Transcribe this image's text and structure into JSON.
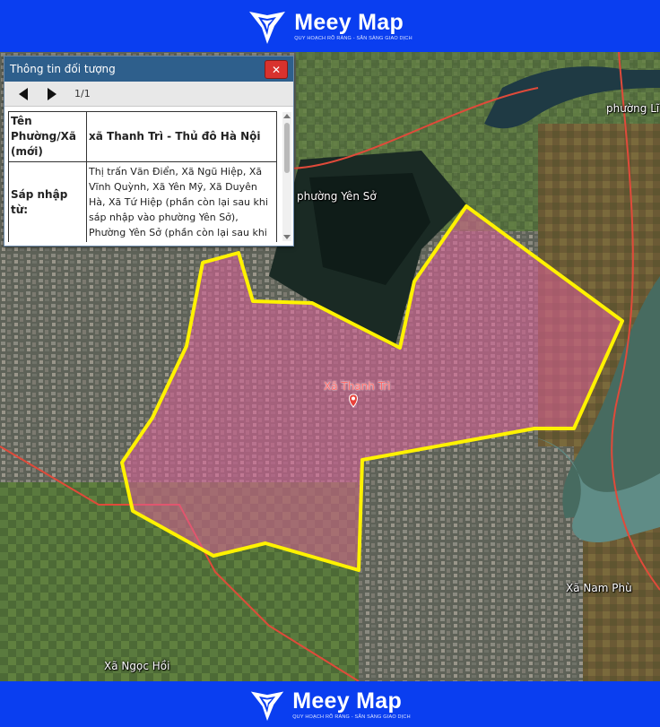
{
  "brand": {
    "name": "Meey Map",
    "tagline": "QUY HOẠCH RÕ RÀNG - SẴN SÀNG GIAO DỊCH"
  },
  "panel": {
    "title": "Thông tin đối tượng",
    "close_label": "✕",
    "pager": "1/1",
    "rows": [
      {
        "key": "Tên Phường/Xã (mới)",
        "value": "xã Thanh Trì - Thủ đô Hà Nội"
      },
      {
        "key": "Sáp nhập từ:",
        "value": "Thị trấn Văn Điển, Xã Ngũ Hiệp, Xã Vĩnh Quỳnh, Xã Yên Mỹ, Xã Duyên Hà, Xã Tứ Hiệp (phần còn lại sau khi sáp nhập vào phường Yên Sở), Phường Yên Sở (phần còn lại sau khi"
      }
    ]
  },
  "map": {
    "labels": {
      "yen_so": "phường Yên Sở",
      "linh_nam": "phường Lĩ",
      "nam_phu": "Xã Nam Phù",
      "ngoc_hoi": "Xã Ngọc Hồi",
      "pin": "Xã Thanh Trì"
    },
    "colors": {
      "banner": "#0a3ef0",
      "boundary": "#fff200",
      "region_fill": "#e0609a",
      "outer_border": "#e04a3a",
      "pin": "#e8413a"
    }
  }
}
